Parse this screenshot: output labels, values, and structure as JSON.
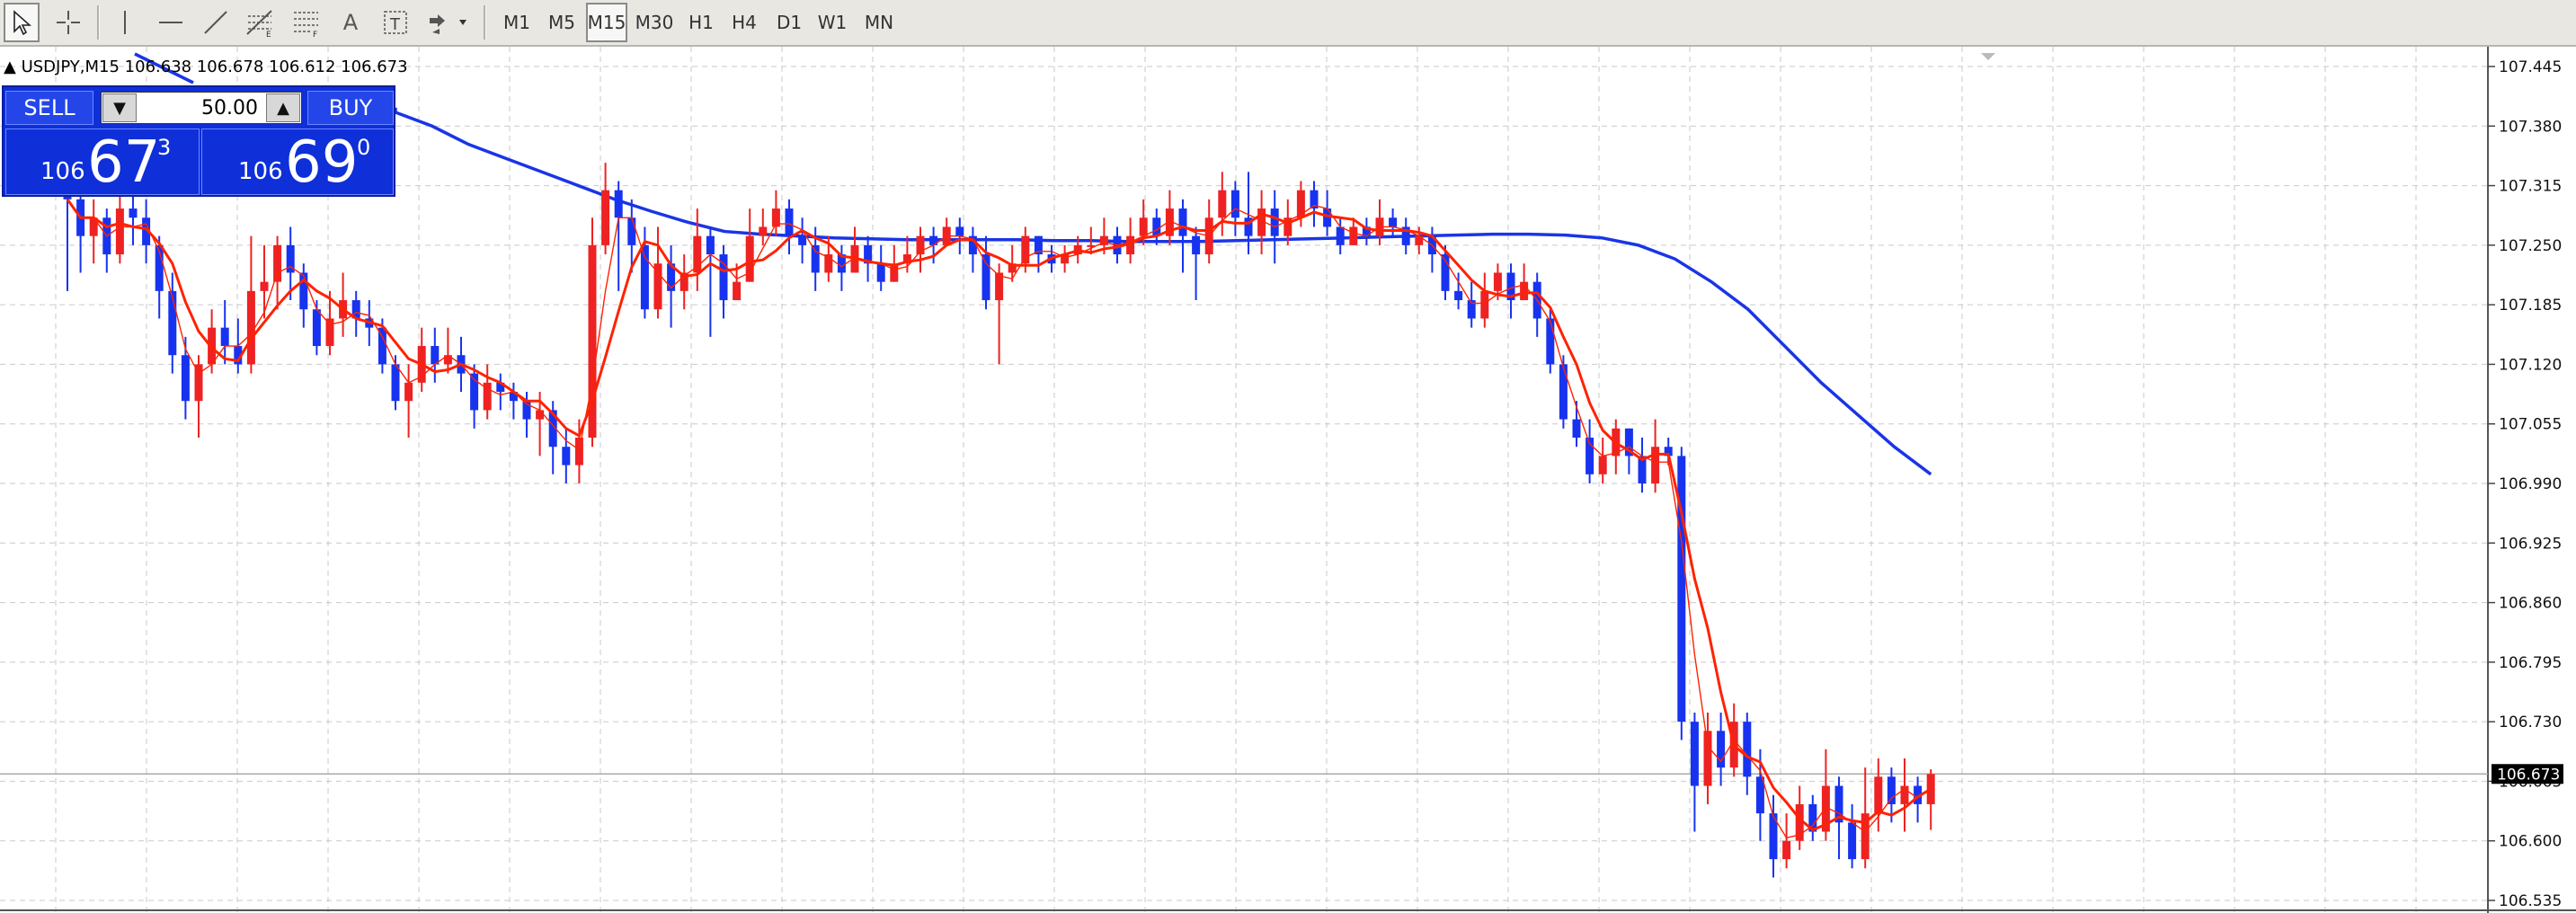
{
  "toolbar": {
    "tools": [
      "cursor-icon",
      "crosshair-icon",
      "vertical-line-icon",
      "horizontal-line-icon",
      "trendline-icon",
      "fibonacci-icon",
      "fibonacci-fan-icon",
      "text-icon",
      "text-label-icon",
      "arrows-icon"
    ],
    "text_tool_label": "A",
    "timeframes": [
      "M1",
      "M5",
      "M15",
      "M30",
      "H1",
      "H4",
      "D1",
      "W1",
      "MN"
    ],
    "active_timeframe": "M15"
  },
  "chart": {
    "symbol_line": "USDJPY,M15  106.638 106.678 106.612 106.673",
    "current_price": "106.673",
    "price_ticks": [
      "107.445",
      "107.380",
      "107.315",
      "107.250",
      "107.185",
      "107.120",
      "107.055",
      "106.990",
      "106.925",
      "106.860",
      "106.795",
      "106.730",
      "106.665",
      "106.600",
      "106.535"
    ]
  },
  "trade_panel": {
    "sell_label": "SELL",
    "buy_label": "BUY",
    "volume": "50.00",
    "sell_price_prefix": "106",
    "sell_price_big": "67",
    "sell_price_sup": "3",
    "buy_price_prefix": "106",
    "buy_price_big": "69",
    "buy_price_sup": "0"
  },
  "colors": {
    "bull_candle": "#ee2222",
    "bear_candle": "#1733f0",
    "ma_slow": "#1a35e6",
    "ma_fast": "#ff2200",
    "grid": "#c9c9c9"
  },
  "chart_data": {
    "type": "candlestick",
    "ylim": [
      106.535,
      107.445
    ],
    "grid": true,
    "candles": [
      [
        107.35,
        107.3,
        107.39,
        107.2
      ],
      [
        107.3,
        107.26,
        107.31,
        107.22
      ],
      [
        107.26,
        107.28,
        107.3,
        107.23
      ],
      [
        107.28,
        107.24,
        107.29,
        107.22
      ],
      [
        107.24,
        107.29,
        107.31,
        107.23
      ],
      [
        107.29,
        107.28,
        107.31,
        107.25
      ],
      [
        107.28,
        107.25,
        107.3,
        107.23
      ],
      [
        107.25,
        107.2,
        107.26,
        107.17
      ],
      [
        107.2,
        107.13,
        107.22,
        107.11
      ],
      [
        107.13,
        107.08,
        107.15,
        107.06
      ],
      [
        107.08,
        107.12,
        107.13,
        107.04
      ],
      [
        107.12,
        107.16,
        107.18,
        107.11
      ],
      [
        107.16,
        107.14,
        107.19,
        107.12
      ],
      [
        107.14,
        107.12,
        107.17,
        107.11
      ],
      [
        107.12,
        107.2,
        107.26,
        107.11
      ],
      [
        107.2,
        107.21,
        107.25,
        107.17
      ],
      [
        107.21,
        107.25,
        107.26,
        107.18
      ],
      [
        107.25,
        107.22,
        107.27,
        107.19
      ],
      [
        107.22,
        107.18,
        107.23,
        107.16
      ],
      [
        107.18,
        107.14,
        107.19,
        107.13
      ],
      [
        107.14,
        107.17,
        107.2,
        107.13
      ],
      [
        107.17,
        107.19,
        107.22,
        107.15
      ],
      [
        107.19,
        107.17,
        107.2,
        107.15
      ],
      [
        107.17,
        107.16,
        107.19,
        107.14
      ],
      [
        107.16,
        107.12,
        107.17,
        107.11
      ],
      [
        107.12,
        107.08,
        107.13,
        107.07
      ],
      [
        107.08,
        107.1,
        107.12,
        107.04
      ],
      [
        107.1,
        107.14,
        107.16,
        107.09
      ],
      [
        107.14,
        107.12,
        107.16,
        107.1
      ],
      [
        107.12,
        107.13,
        107.16,
        107.11
      ],
      [
        107.13,
        107.11,
        107.15,
        107.09
      ],
      [
        107.11,
        107.07,
        107.12,
        107.05
      ],
      [
        107.07,
        107.1,
        107.12,
        107.06
      ],
      [
        107.1,
        107.09,
        107.11,
        107.07
      ],
      [
        107.09,
        107.08,
        107.1,
        107.06
      ],
      [
        107.08,
        107.06,
        107.09,
        107.04
      ],
      [
        107.06,
        107.07,
        107.09,
        107.02
      ],
      [
        107.07,
        107.03,
        107.08,
        107.0
      ],
      [
        107.03,
        107.01,
        107.05,
        106.99
      ],
      [
        107.01,
        107.04,
        107.06,
        106.99
      ],
      [
        107.04,
        107.25,
        107.28,
        107.03
      ],
      [
        107.25,
        107.31,
        107.34,
        107.24
      ],
      [
        107.31,
        107.28,
        107.32,
        107.2
      ],
      [
        107.28,
        107.25,
        107.3,
        107.22
      ],
      [
        107.25,
        107.18,
        107.27,
        107.17
      ],
      [
        107.18,
        107.23,
        107.27,
        107.17
      ],
      [
        107.23,
        107.2,
        107.25,
        107.16
      ],
      [
        107.2,
        107.22,
        107.24,
        107.18
      ],
      [
        107.22,
        107.26,
        107.29,
        107.2
      ],
      [
        107.26,
        107.24,
        107.27,
        107.15
      ],
      [
        107.24,
        107.19,
        107.25,
        107.17
      ],
      [
        107.19,
        107.21,
        107.23,
        107.19
      ],
      [
        107.21,
        107.26,
        107.29,
        107.21
      ],
      [
        107.26,
        107.27,
        107.29,
        107.25
      ],
      [
        107.27,
        107.29,
        107.31,
        107.26
      ],
      [
        107.29,
        107.26,
        107.3,
        107.24
      ],
      [
        107.26,
        107.25,
        107.28,
        107.23
      ],
      [
        107.25,
        107.22,
        107.27,
        107.2
      ],
      [
        107.22,
        107.24,
        107.26,
        107.21
      ],
      [
        107.24,
        107.22,
        107.25,
        107.2
      ],
      [
        107.22,
        107.25,
        107.27,
        107.22
      ],
      [
        107.25,
        107.23,
        107.26,
        107.21
      ],
      [
        107.23,
        107.21,
        107.25,
        107.2
      ],
      [
        107.21,
        107.23,
        107.25,
        107.21
      ],
      [
        107.23,
        107.24,
        107.26,
        107.22
      ],
      [
        107.24,
        107.26,
        107.27,
        107.22
      ],
      [
        107.26,
        107.25,
        107.27,
        107.23
      ],
      [
        107.25,
        107.27,
        107.28,
        107.25
      ],
      [
        107.27,
        107.26,
        107.28,
        107.24
      ],
      [
        107.26,
        107.24,
        107.27,
        107.22
      ],
      [
        107.24,
        107.19,
        107.26,
        107.18
      ],
      [
        107.19,
        107.22,
        107.23,
        107.12
      ],
      [
        107.22,
        107.23,
        107.25,
        107.21
      ],
      [
        107.23,
        107.26,
        107.27,
        107.22
      ],
      [
        107.26,
        107.24,
        107.26,
        107.22
      ],
      [
        107.24,
        107.23,
        107.25,
        107.22
      ],
      [
        107.23,
        107.24,
        107.25,
        107.22
      ],
      [
        107.24,
        107.25,
        107.26,
        107.23
      ],
      [
        107.25,
        107.25,
        107.27,
        107.24
      ],
      [
        107.25,
        107.26,
        107.28,
        107.24
      ],
      [
        107.26,
        107.24,
        107.27,
        107.23
      ],
      [
        107.24,
        107.26,
        107.28,
        107.23
      ],
      [
        107.26,
        107.28,
        107.3,
        107.25
      ],
      [
        107.28,
        107.26,
        107.29,
        107.25
      ],
      [
        107.26,
        107.29,
        107.31,
        107.25
      ],
      [
        107.29,
        107.26,
        107.3,
        107.22
      ],
      [
        107.26,
        107.24,
        107.27,
        107.19
      ],
      [
        107.24,
        107.28,
        107.3,
        107.23
      ],
      [
        107.28,
        107.31,
        107.33,
        107.26
      ],
      [
        107.31,
        107.28,
        107.32,
        107.26
      ],
      [
        107.28,
        107.26,
        107.33,
        107.24
      ],
      [
        107.26,
        107.29,
        107.31,
        107.24
      ],
      [
        107.29,
        107.26,
        107.31,
        107.23
      ],
      [
        107.26,
        107.28,
        107.3,
        107.25
      ],
      [
        107.28,
        107.31,
        107.32,
        107.27
      ],
      [
        107.31,
        107.29,
        107.32,
        107.27
      ],
      [
        107.29,
        107.27,
        107.31,
        107.26
      ],
      [
        107.27,
        107.25,
        107.28,
        107.24
      ],
      [
        107.25,
        107.27,
        107.28,
        107.25
      ],
      [
        107.27,
        107.26,
        107.28,
        107.25
      ],
      [
        107.26,
        107.28,
        107.3,
        107.25
      ],
      [
        107.28,
        107.27,
        107.29,
        107.26
      ],
      [
        107.27,
        107.25,
        107.28,
        107.24
      ],
      [
        107.25,
        107.26,
        107.27,
        107.24
      ],
      [
        107.26,
        107.24,
        107.27,
        107.22
      ],
      [
        107.24,
        107.2,
        107.25,
        107.19
      ],
      [
        107.2,
        107.19,
        107.22,
        107.18
      ],
      [
        107.19,
        107.17,
        107.21,
        107.16
      ],
      [
        107.17,
        107.2,
        107.22,
        107.16
      ],
      [
        107.2,
        107.22,
        107.23,
        107.19
      ],
      [
        107.22,
        107.19,
        107.23,
        107.17
      ],
      [
        107.19,
        107.21,
        107.23,
        107.19
      ],
      [
        107.21,
        107.17,
        107.22,
        107.15
      ],
      [
        107.17,
        107.12,
        107.18,
        107.11
      ],
      [
        107.12,
        107.06,
        107.13,
        107.05
      ],
      [
        107.06,
        107.04,
        107.08,
        107.03
      ],
      [
        107.04,
        107.0,
        107.06,
        106.99
      ],
      [
        107.0,
        107.02,
        107.04,
        106.99
      ],
      [
        107.02,
        107.05,
        107.06,
        107.0
      ],
      [
        107.05,
        107.02,
        107.05,
        107.0
      ],
      [
        107.02,
        106.99,
        107.04,
        106.98
      ],
      [
        106.99,
        107.03,
        107.06,
        106.98
      ],
      [
        107.03,
        107.02,
        107.04,
        107.01
      ],
      [
        107.02,
        106.73,
        107.03,
        106.71
      ],
      [
        106.73,
        106.66,
        106.74,
        106.61
      ],
      [
        106.66,
        106.72,
        106.74,
        106.64
      ],
      [
        106.72,
        106.68,
        106.74,
        106.66
      ],
      [
        106.68,
        106.73,
        106.75,
        106.67
      ],
      [
        106.73,
        106.67,
        106.74,
        106.65
      ],
      [
        106.67,
        106.63,
        106.7,
        106.6
      ],
      [
        106.63,
        106.58,
        106.65,
        106.56
      ],
      [
        106.58,
        106.6,
        106.63,
        106.57
      ],
      [
        106.6,
        106.64,
        106.66,
        106.59
      ],
      [
        106.64,
        106.61,
        106.65,
        106.6
      ],
      [
        106.61,
        106.66,
        106.7,
        106.6
      ],
      [
        106.66,
        106.62,
        106.67,
        106.58
      ],
      [
        106.62,
        106.58,
        106.64,
        106.57
      ],
      [
        106.58,
        106.63,
        106.68,
        106.57
      ],
      [
        106.63,
        106.67,
        106.69,
        106.61
      ],
      [
        106.67,
        106.64,
        106.68,
        106.62
      ],
      [
        106.64,
        106.66,
        106.69,
        106.61
      ],
      [
        106.66,
        106.64,
        106.67,
        106.62
      ],
      [
        106.64,
        106.673,
        106.678,
        106.612
      ]
    ],
    "ma_fast_period_note": "red lines are short moving averages; blue line is a long moving average",
    "ma_slow": [
      107.395,
      107.38,
      107.36,
      107.345,
      107.33,
      107.315,
      107.3,
      107.287,
      107.275,
      107.265,
      107.262,
      107.26,
      107.258,
      107.257,
      107.256,
      107.256,
      107.256,
      107.256,
      107.255,
      107.255,
      107.254,
      107.254,
      107.254,
      107.255,
      107.256,
      107.257,
      107.258,
      107.259,
      107.26,
      107.261,
      107.262,
      107.262,
      107.261,
      107.258,
      107.25,
      107.235,
      107.21,
      107.18,
      107.14,
      107.1,
      107.065,
      107.03,
      107.0
    ],
    "ma_slow_start_index": 62
  }
}
